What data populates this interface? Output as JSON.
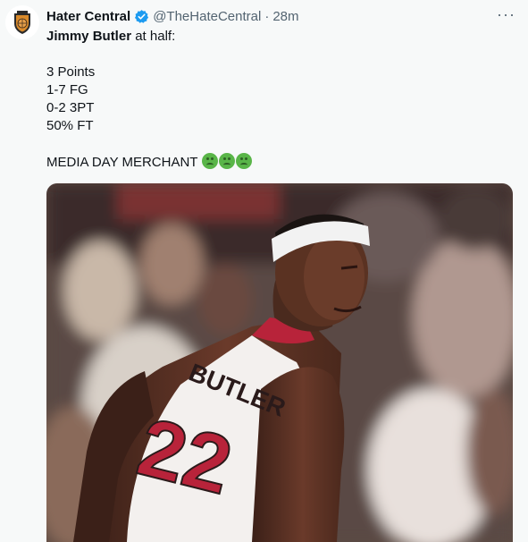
{
  "author": {
    "name": "Hater Central",
    "handle": "@TheHateCentral",
    "separator": "·",
    "time": "28m",
    "avatar_icon": "basketball-crest-icon",
    "verified_icon": "verified-badge-icon",
    "verified_color": "#1d9bf0"
  },
  "menu": {
    "more_label": "···"
  },
  "post": {
    "player_name": "Jimmy Butler",
    "intro_rest": " at half:",
    "stats": [
      "3 Points",
      "1-7 FG",
      "0-2 3PT",
      "50% FT"
    ],
    "closing": "MEDIA DAY MERCHANT",
    "emoji_icon": "nauseated-face-icon",
    "emoji_count": 3
  },
  "media": {
    "jersey_name": "BUTLER",
    "jersey_number": "22",
    "jersey_colors": {
      "base": "#f3f0ee",
      "trim": "#b8233a"
    }
  }
}
